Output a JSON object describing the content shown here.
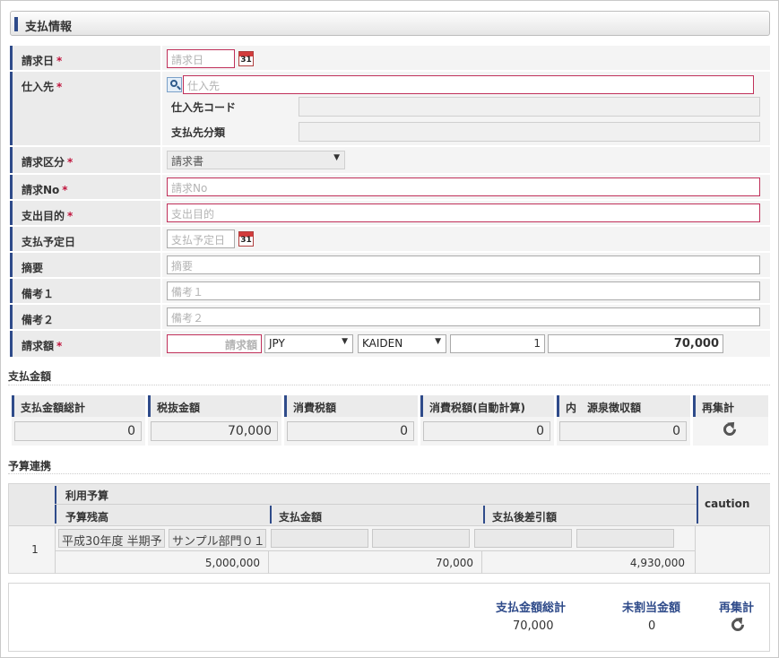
{
  "section_title": "支払情報",
  "form": {
    "invoice_date": {
      "label": "請求日",
      "required": true,
      "placeholder": "請求日"
    },
    "supplier": {
      "label": "仕入先",
      "required": true,
      "placeholder": "仕入先",
      "code_label": "仕入先コード",
      "class_label": "支払先分類"
    },
    "invoice_type": {
      "label": "請求区分",
      "required": true,
      "value": "請求書"
    },
    "invoice_no": {
      "label": "請求No",
      "required": true,
      "placeholder": "請求No"
    },
    "purpose": {
      "label": "支出目的",
      "required": true,
      "placeholder": "支出目的"
    },
    "planned_date": {
      "label": "支払予定日",
      "placeholder": "支払予定日"
    },
    "summary": {
      "label": "摘要",
      "placeholder": "摘要"
    },
    "note1": {
      "label": "備考１",
      "placeholder": "備考１"
    },
    "note2": {
      "label": "備考２",
      "placeholder": "備考２"
    },
    "amount": {
      "label": "請求額",
      "required": true,
      "placeholder": "請求額",
      "currency": "JPY",
      "rate_type": "KAIDEN",
      "rate": "1",
      "converted": "70,000"
    },
    "required_mark": "*",
    "calendar_day": "31"
  },
  "payment_amount": {
    "heading": "支払金額",
    "columns": [
      "支払金額総計",
      "税抜金額",
      "消費税額",
      "消費税額(自動計算)",
      "内　源泉徴収額",
      "再集計"
    ],
    "values": [
      "0",
      "70,000",
      "0",
      "0",
      "0"
    ]
  },
  "budget": {
    "heading": "予算連携",
    "group_header": "利用予算",
    "columns": [
      "予算残高",
      "支払金額",
      "支払後差引額"
    ],
    "caution_header": "caution",
    "rows": [
      {
        "index": "1",
        "budget_period": "平成30年度 半期予",
        "department": "サンプル部門０１",
        "balance": "5,000,000",
        "payment": "70,000",
        "after": "4,930,000"
      }
    ]
  },
  "summary_panel": {
    "total_label": "支払金額総計",
    "total_value": "70,000",
    "unallocated_label": "未割当金額",
    "unallocated_value": "0",
    "recalc_label": "再集計"
  },
  "colors": {
    "accent": "#2f4b8a",
    "required": "#c0143c"
  }
}
